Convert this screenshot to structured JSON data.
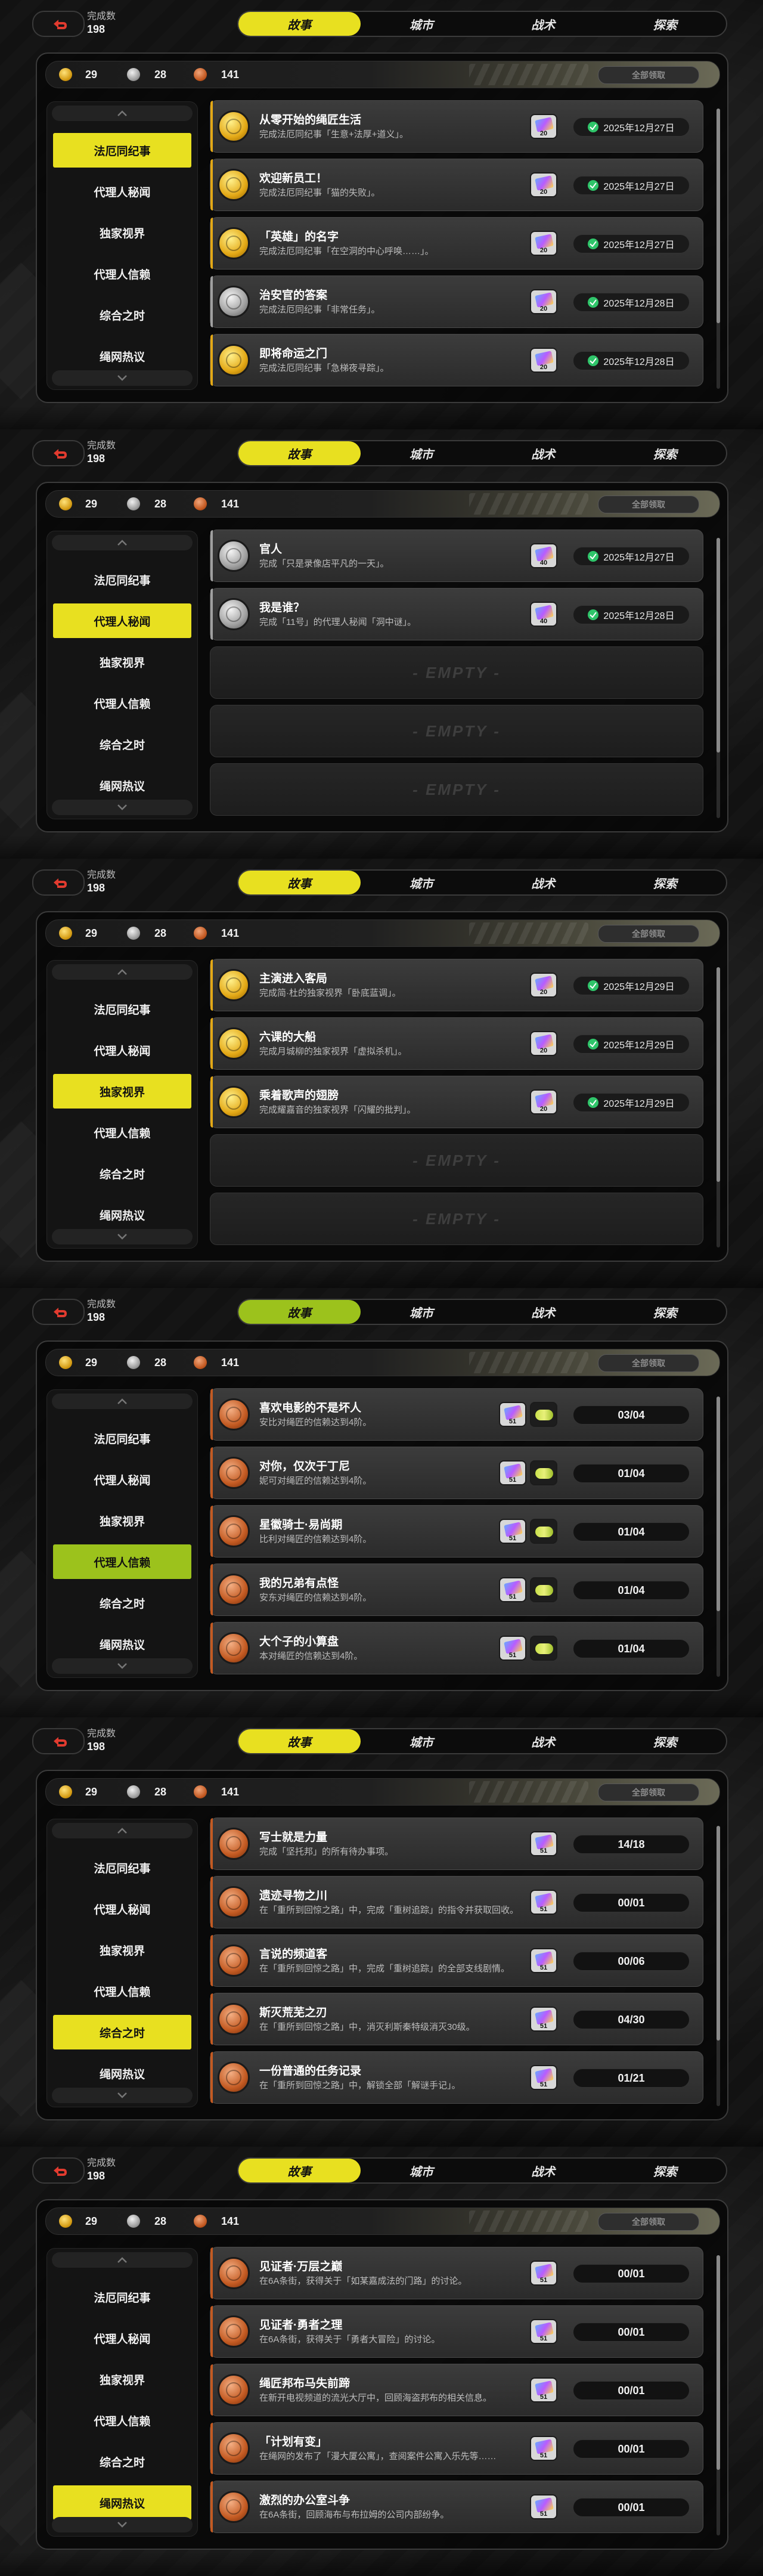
{
  "colors": {
    "accent": "#e8e020",
    "accent_alt": "#9cc21c",
    "panel_bg": "#0a0a0a",
    "row_bg": "#353535",
    "success": "#2fc56a"
  },
  "screens": [
    {
      "accent": "#e8e020",
      "topbar": {
        "count_label": "完成数",
        "count_value": "198",
        "tabs": [
          "故事",
          "城市",
          "战术",
          "探索"
        ],
        "active_tab": 0
      },
      "header": {
        "gold": "29",
        "silver": "28",
        "bronze": "141",
        "claim_all": "全部领取"
      },
      "sidebar": {
        "items": [
          "法厄同纪事",
          "代理人秘闻",
          "独家视界",
          "代理人信赖",
          "综合之时",
          "绳网热议"
        ],
        "active": 0
      },
      "rows": [
        {
          "empty": false,
          "icon": "gold-medal-icon",
          "tier": "gold",
          "title": "从零开始的绳匠生活",
          "subtitle": "完成法厄同纪事「生意+法厚+道义」。",
          "reward_qty": "20",
          "status_type": "date",
          "status": "2025年12月27日"
        },
        {
          "empty": false,
          "icon": "gold-medal-icon",
          "tier": "gold",
          "title": "欢迎新员工！",
          "subtitle": "完成法厄同纪事「猫的失败」。",
          "reward_qty": "20",
          "status_type": "date",
          "status": "2025年12月27日"
        },
        {
          "empty": false,
          "icon": "gold-medal-icon",
          "tier": "gold",
          "title": "「英雄」的名字",
          "subtitle": "完成法厄同纪事「在空洞的中心呼唤……」。",
          "reward_qty": "20",
          "status_type": "date",
          "status": "2025年12月27日"
        },
        {
          "empty": false,
          "icon": "silver-medal-icon",
          "tier": "silver",
          "title": "治安官的答案",
          "subtitle": "完成法厄同纪事「非常任务」。",
          "reward_qty": "20",
          "status_type": "date",
          "status": "2025年12月28日"
        },
        {
          "empty": false,
          "icon": "gold-medal-icon",
          "tier": "gold",
          "title": "即将命运之门",
          "subtitle": "完成法厄同纪事「急梯夜寻踪」。",
          "reward_qty": "20",
          "status_type": "date",
          "status": "2025年12月28日"
        }
      ]
    },
    {
      "accent": "#e8e020",
      "topbar": {
        "count_label": "完成数",
        "count_value": "198",
        "tabs": [
          "故事",
          "城市",
          "战术",
          "探索"
        ],
        "active_tab": 0
      },
      "header": {
        "gold": "29",
        "silver": "28",
        "bronze": "141",
        "claim_all": "全部领取"
      },
      "sidebar": {
        "items": [
          "法厄同纪事",
          "代理人秘闻",
          "独家视界",
          "代理人信赖",
          "综合之时",
          "绳网热议"
        ],
        "active": 1
      },
      "rows": [
        {
          "empty": false,
          "icon": "silver-medal-icon",
          "tier": "silver",
          "title": "官人",
          "subtitle": "完成「只是录像店平凡的一天」。",
          "reward_qty": "40",
          "status_type": "date",
          "status": "2025年12月27日"
        },
        {
          "empty": false,
          "icon": "silver-medal-icon",
          "tier": "silver",
          "title": "我是谁？",
          "subtitle": "完成「11号」的代理人秘闻「洞中谜」。",
          "reward_qty": "40",
          "status_type": "date",
          "status": "2025年12月28日"
        },
        {
          "empty": true,
          "empty_label": "- EMPTY -"
        },
        {
          "empty": true,
          "empty_label": "- EMPTY -"
        },
        {
          "empty": true,
          "empty_label": "- EMPTY -"
        }
      ]
    },
    {
      "accent": "#e8e020",
      "topbar": {
        "count_label": "完成数",
        "count_value": "198",
        "tabs": [
          "故事",
          "城市",
          "战术",
          "探索"
        ],
        "active_tab": 0
      },
      "header": {
        "gold": "29",
        "silver": "28",
        "bronze": "141",
        "claim_all": "全部领取"
      },
      "sidebar": {
        "items": [
          "法厄同纪事",
          "代理人秘闻",
          "独家视界",
          "代理人信赖",
          "综合之时",
          "绳网热议"
        ],
        "active": 2
      },
      "rows": [
        {
          "empty": false,
          "icon": "gold-medal-icon",
          "tier": "gold",
          "title": "主演进入客局",
          "subtitle": "完成简·杜的独家视界「卧底蓝调」。",
          "reward_qty": "20",
          "status_type": "date",
          "status": "2025年12月29日"
        },
        {
          "empty": false,
          "icon": "gold-medal-icon",
          "tier": "gold",
          "title": "六课的大船",
          "subtitle": "完成月城柳的独家视界「虚拟杀机」。",
          "reward_qty": "20",
          "status_type": "date",
          "status": "2025年12月29日"
        },
        {
          "empty": false,
          "icon": "gold-medal-icon",
          "tier": "gold",
          "title": "乘着歌声的翅膀",
          "subtitle": "完成耀嘉音的独家视界「闪耀的批判」。",
          "reward_qty": "20",
          "status_type": "date",
          "status": "2025年12月29日"
        },
        {
          "empty": true,
          "empty_label": "- EMPTY -"
        },
        {
          "empty": true,
          "empty_label": "- EMPTY -"
        }
      ]
    },
    {
      "accent": "#9cc21c",
      "topbar": {
        "count_label": "完成数",
        "count_value": "198",
        "tabs": [
          "故事",
          "城市",
          "战术",
          "探索"
        ],
        "active_tab": 0
      },
      "header": {
        "gold": "29",
        "silver": "28",
        "bronze": "141",
        "claim_all": "全部领取"
      },
      "sidebar": {
        "items": [
          "法厄同纪事",
          "代理人秘闻",
          "独家视界",
          "代理人信赖",
          "综合之时",
          "绳网热议"
        ],
        "active": 3
      },
      "rows": [
        {
          "empty": false,
          "icon": "bronze-medal-icon",
          "tier": "bronze",
          "title": "喜欢电影的不是坏人",
          "subtitle": "安比对绳匠的信赖达到4阶。",
          "reward_qty": "51",
          "double_reward": true,
          "status_type": "progress",
          "status": "03/04"
        },
        {
          "empty": false,
          "icon": "bronze-medal-icon",
          "tier": "bronze",
          "title": "对你，仅次于丁尼",
          "subtitle": "妮可对绳匠的信赖达到4阶。",
          "reward_qty": "51",
          "double_reward": true,
          "status_type": "progress",
          "status": "01/04"
        },
        {
          "empty": false,
          "icon": "bronze-medal-icon",
          "tier": "bronze",
          "title": "星徽骑士·易尚期",
          "subtitle": "比利对绳匠的信赖达到4阶。",
          "reward_qty": "51",
          "double_reward": true,
          "status_type": "progress",
          "status": "01/04"
        },
        {
          "empty": false,
          "icon": "bronze-medal-icon",
          "tier": "bronze",
          "title": "我的兄弟有点怪",
          "subtitle": "安东对绳匠的信赖达到4阶。",
          "reward_qty": "51",
          "double_reward": true,
          "status_type": "progress",
          "status": "01/04"
        },
        {
          "empty": false,
          "icon": "bronze-medal-icon",
          "tier": "bronze",
          "title": "大个子的小算盘",
          "subtitle": "本对绳匠的信赖达到4阶。",
          "reward_qty": "51",
          "double_reward": true,
          "status_type": "progress",
          "status": "01/04"
        }
      ]
    },
    {
      "accent": "#e8e020",
      "topbar": {
        "count_label": "完成数",
        "count_value": "198",
        "tabs": [
          "故事",
          "城市",
          "战术",
          "探索"
        ],
        "active_tab": 0
      },
      "header": {
        "gold": "29",
        "silver": "28",
        "bronze": "141",
        "claim_all": "全部领取"
      },
      "sidebar": {
        "items": [
          "法厄同纪事",
          "代理人秘闻",
          "独家视界",
          "代理人信赖",
          "综合之时",
          "绳网热议"
        ],
        "active": 4
      },
      "rows": [
        {
          "empty": false,
          "icon": "bronze-medal-icon",
          "tier": "bronze",
          "title": "写士就是力量",
          "subtitle": "完成「坚托邦」的所有待办事项。",
          "reward_qty": "51",
          "status_type": "progress",
          "status": "14/18"
        },
        {
          "empty": false,
          "icon": "bronze-medal-icon",
          "tier": "bronze",
          "title": "遗迹寻物之川",
          "subtitle": "在「重所到回惊之路」中，完成「重树追踪」的指令并获取回收。",
          "reward_qty": "51",
          "status_type": "progress",
          "status": "00/01"
        },
        {
          "empty": false,
          "icon": "bronze-medal-icon",
          "tier": "bronze",
          "title": "言说的频道客",
          "subtitle": "在「重所到回惊之路」中，完成「重树追踪」的全部支线剧情。",
          "reward_qty": "51",
          "status_type": "progress",
          "status": "00/06"
        },
        {
          "empty": false,
          "icon": "bronze-medal-icon",
          "tier": "bronze",
          "title": "斯灭荒芜之刃",
          "subtitle": "在「重所到回惊之路」中，消灭利斯秦特级消灭30级。",
          "reward_qty": "51",
          "status_type": "progress",
          "status": "04/30"
        },
        {
          "empty": false,
          "icon": "bronze-medal-icon",
          "tier": "bronze",
          "title": "一份普通的任务记录",
          "subtitle": "在「重所到回惊之路」中，解锁全部「解谜手记」。",
          "reward_qty": "51",
          "status_type": "progress",
          "status": "01/21"
        }
      ]
    },
    {
      "accent": "#e8e020",
      "topbar": {
        "count_label": "完成数",
        "count_value": "198",
        "tabs": [
          "故事",
          "城市",
          "战术",
          "探索"
        ],
        "active_tab": 0
      },
      "header": {
        "gold": "29",
        "silver": "28",
        "bronze": "141",
        "claim_all": "全部领取"
      },
      "sidebar": {
        "items": [
          "法厄同纪事",
          "代理人秘闻",
          "独家视界",
          "代理人信赖",
          "综合之时",
          "绳网热议"
        ],
        "active": 5
      },
      "rows": [
        {
          "empty": false,
          "icon": "bronze-medal-icon",
          "tier": "bronze",
          "title": "见证者·万层之巅",
          "subtitle": "在6A条街，获得关于「如某嘉成法的门路」的讨论。",
          "reward_qty": "51",
          "status_type": "progress",
          "status": "00/01"
        },
        {
          "empty": false,
          "icon": "bronze-medal-icon",
          "tier": "bronze",
          "title": "见证者·勇者之理",
          "subtitle": "在6A条街，获得关于「勇者大冒险」的讨论。",
          "reward_qty": "51",
          "status_type": "progress",
          "status": "00/01"
        },
        {
          "empty": false,
          "icon": "bronze-medal-icon",
          "tier": "bronze",
          "title": "绳匠邦布马失前蹄",
          "subtitle": "在新开电视频道的流光大厅中，回顾海盗邦布的相关信息。",
          "reward_qty": "51",
          "status_type": "progress",
          "status": "00/01"
        },
        {
          "empty": false,
          "icon": "bronze-medal-icon",
          "tier": "bronze",
          "title": "「计划有变」",
          "subtitle": "在绳网的发布了「漫大厦公寓」，查阅案件公寓入乐先等……",
          "reward_qty": "51",
          "status_type": "progress",
          "status": "00/01"
        },
        {
          "empty": false,
          "icon": "bronze-medal-icon",
          "tier": "bronze",
          "title": "激烈的办公室斗争",
          "subtitle": "在6A条街，回顾海布与布拉姆的公司内部纷争。",
          "reward_qty": "51",
          "status_type": "progress",
          "status": "00/01"
        }
      ]
    }
  ]
}
